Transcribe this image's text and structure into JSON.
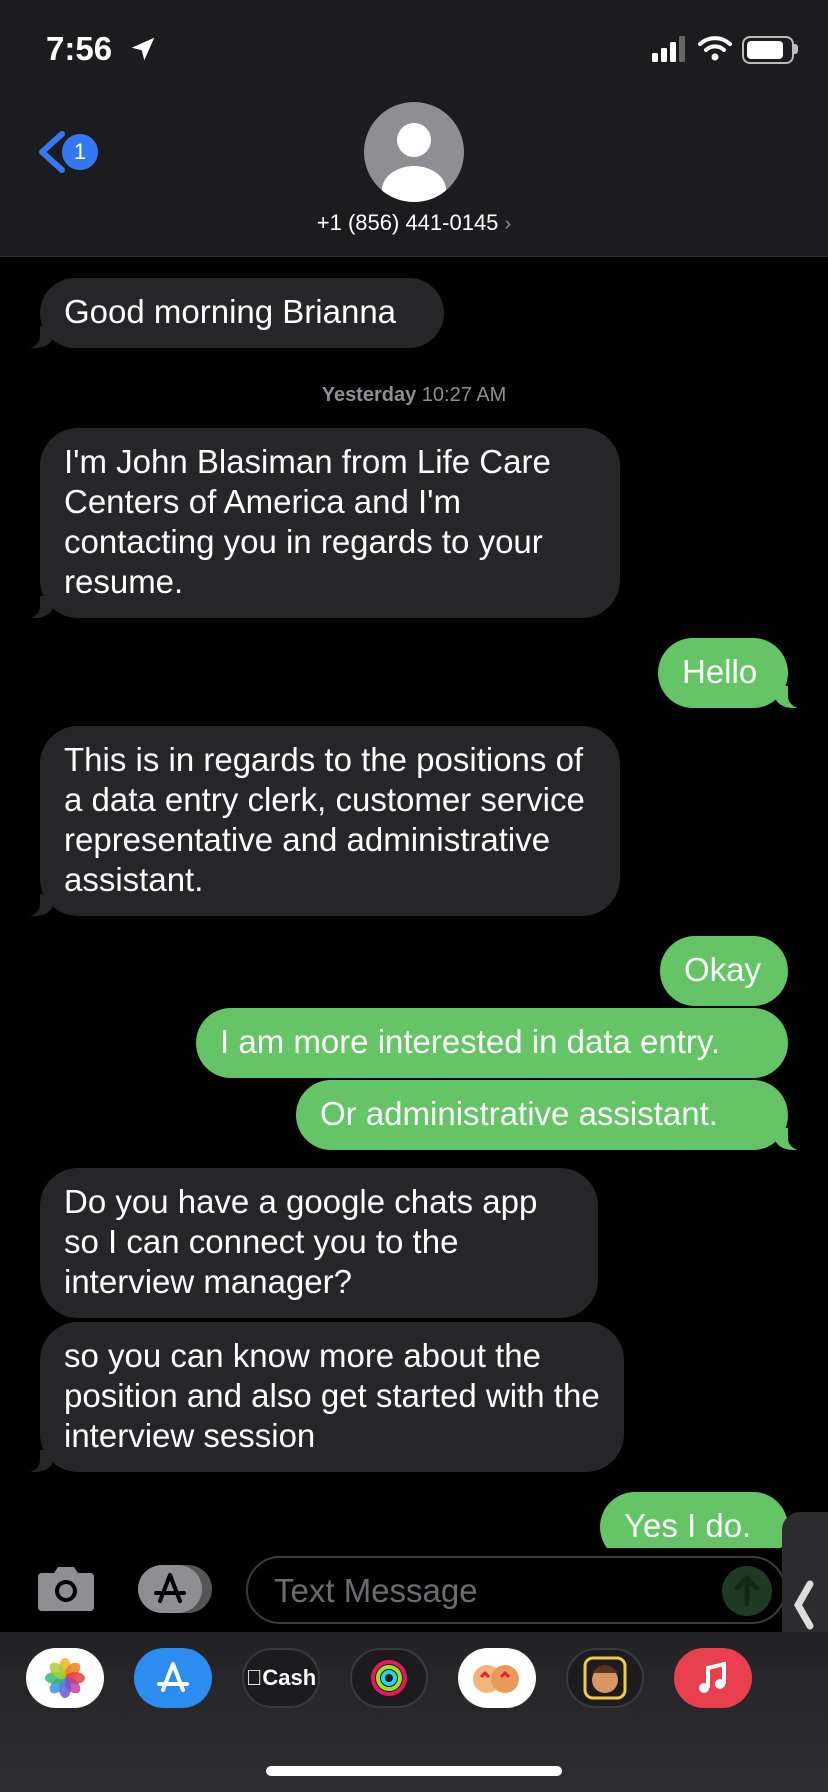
{
  "status": {
    "time": "7:56",
    "battery_level": 0.85
  },
  "header": {
    "back_badge": "1",
    "contact": "+1 (856) 441-0145",
    "chevron": "›"
  },
  "conversation": {
    "timestamp_day": "Yesterday",
    "timestamp_time": "10:27 AM",
    "messages": [
      {
        "from": "them",
        "text": "Good morning Brianna"
      },
      {
        "from": "them",
        "text": "I'm John Blasiman from Life Care Centers of America and I'm contacting you in regards to your resume."
      },
      {
        "from": "me",
        "text": "Hello"
      },
      {
        "from": "them",
        "text": "This is in regards to the positions of a data entry clerk, customer service representative and administrative assistant."
      },
      {
        "from": "me",
        "text": "Okay"
      },
      {
        "from": "me",
        "text": "I am more interested in data entry."
      },
      {
        "from": "me",
        "text": "Or administrative assistant."
      },
      {
        "from": "them",
        "text": "Do you have a google chats app so I can connect you to the interview manager?"
      },
      {
        "from": "them",
        "text": "so you can know more about the position and also get started with the interview session"
      },
      {
        "from": "me",
        "text": "Yes I do."
      }
    ]
  },
  "input": {
    "placeholder": "Text Message"
  },
  "apps": [
    {
      "name": "photos-icon",
      "bg": "#ffffff"
    },
    {
      "name": "app-store-icon",
      "bg": "#2d8cf0"
    },
    {
      "name": "apple-cash-icon",
      "bg": "#1c1c1e",
      "label": "Cash"
    },
    {
      "name": "fitness-icon",
      "bg": "#1c1c1e"
    },
    {
      "name": "memoji-stickers-icon",
      "bg": "#ffffff"
    },
    {
      "name": "memoji-icon",
      "bg": "#1c1c1e"
    },
    {
      "name": "music-icon",
      "bg": "#e8404f"
    }
  ],
  "colors": {
    "incoming": "#262629",
    "outgoing": "#65c466",
    "accent": "#3478f6"
  }
}
